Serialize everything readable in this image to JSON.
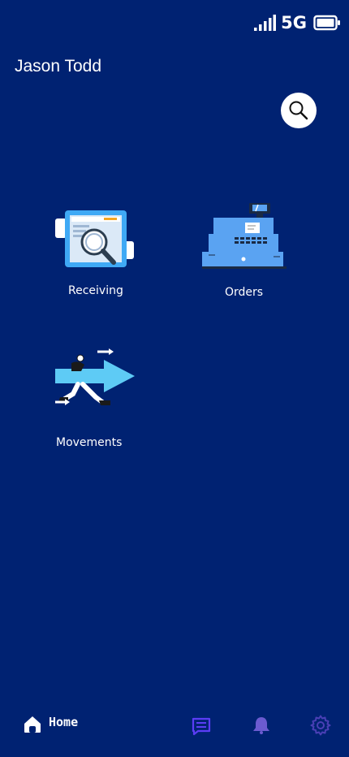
{
  "status_bar": {
    "network": "5G",
    "icons": [
      "signal-icon",
      "battery-icon"
    ]
  },
  "header": {
    "user_name": "Jason Todd",
    "search_icon": "search-icon"
  },
  "tiles": [
    {
      "label": "Receiving",
      "icon": "receiving-illustration"
    },
    {
      "label": "Orders",
      "icon": "cash-register-illustration"
    },
    {
      "label": "Movements",
      "icon": "movements-illustration"
    }
  ],
  "bottom_nav": {
    "home_label": "Home",
    "icons": [
      "home-icon",
      "messages-icon",
      "bell-icon",
      "gear-icon"
    ]
  },
  "colors": {
    "background": "#002272",
    "accent_blue": "#5aa3f2",
    "nav_purple": "#5b3df5",
    "nav_violet": "#6b5bd0"
  }
}
